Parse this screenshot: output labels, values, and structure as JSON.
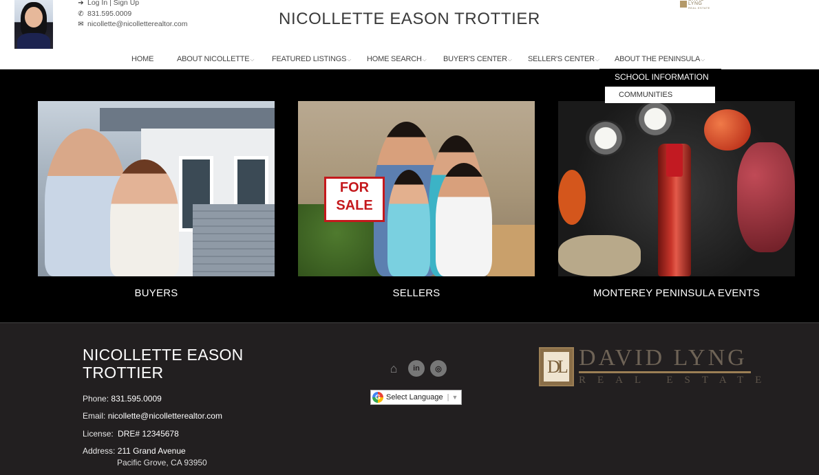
{
  "header": {
    "title": "NICOLLETTE EASON TROTTIER",
    "login_label": "Log In | Sign Up",
    "phone": "831.595.0009",
    "email": "nicollette@nicolletterealtor.com",
    "mini_logo_top": "DAVID LYNG",
    "mini_logo_bottom": "REAL ESTATE"
  },
  "nav": {
    "items": [
      {
        "label": "HOME",
        "has_dropdown": false
      },
      {
        "label": "ABOUT NICOLLETTE",
        "has_dropdown": true
      },
      {
        "label": "FEATURED LISTINGS",
        "has_dropdown": true
      },
      {
        "label": "HOME SEARCH",
        "has_dropdown": true
      },
      {
        "label": "BUYER'S CENTER",
        "has_dropdown": true
      },
      {
        "label": "SELLER'S CENTER",
        "has_dropdown": true
      },
      {
        "label": "ABOUT THE PENINSULA",
        "has_dropdown": true
      }
    ],
    "dropdown": {
      "items": [
        "SCHOOL INFORMATION",
        "COMMUNITIES"
      ]
    }
  },
  "cards": [
    {
      "label": "BUYERS"
    },
    {
      "label": "SELLERS",
      "sign_line1": "FOR",
      "sign_line2": "SALE"
    },
    {
      "label": "MONTEREY PENINSULA EVENTS"
    }
  ],
  "footer": {
    "name_line1": "NICOLLETTE EASON",
    "name_line2": "TROTTIER",
    "phone_label": "Phone:",
    "phone": "831.595.0009",
    "email_label": "Email:",
    "email": "nicollette@nicolletterealtor.com",
    "license_label": "License:",
    "license": "DRE# 12345678",
    "address_label": "Address:",
    "address_line1": "211 Grand Avenue",
    "address_line2": "Pacific Grove, CA 93950",
    "social_icons": [
      "equal-housing-icon",
      "linkedin-icon",
      "instagram-icon"
    ],
    "translate_label": "Select Language",
    "logo_initials": "DL",
    "logo_name": "DAVID LYNG",
    "logo_sub": "REAL ESTATE"
  },
  "colors": {
    "header_bg": "#ffffff",
    "body_bg": "#000000",
    "footer_bg": "#221f20",
    "logo_gold": "#9c7f55"
  }
}
